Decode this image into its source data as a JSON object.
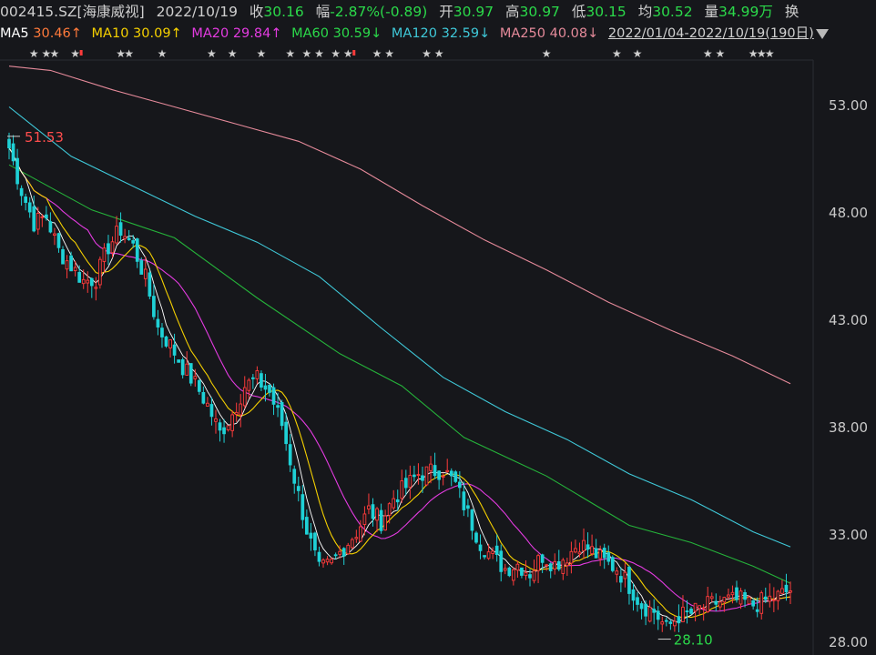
{
  "header": {
    "code": "002415.SZ[海康威视]",
    "date": "2022/10/19",
    "close_label": "收",
    "close": "30.16",
    "change_label": "幅",
    "change": "-2.87%(-0.89)",
    "open_label": "开",
    "open": "30.97",
    "high_label": "高",
    "high": "30.97",
    "low_label": "低",
    "low": "30.15",
    "avg_label": "均",
    "avg": "30.52",
    "vol_label": "量",
    "vol": "34.99万",
    "turnover_label": "换"
  },
  "ma_bar": {
    "ma5_label": "MA5",
    "ma5": "30.46↑",
    "ma10_label": "MA10",
    "ma10": "30.09↑",
    "ma20_label": "MA20",
    "ma20": "29.84↑",
    "ma60_label": "MA60",
    "ma60": "30.59↓",
    "ma120_label": "MA120",
    "ma120": "32.59↓",
    "ma250_label": "MA250",
    "ma250": "40.08↓",
    "range": "2022/01/04-2022/10/19(190日)"
  },
  "colors": {
    "up": "#ff3b3b",
    "down": "#1fd1d6",
    "ma5": "#ffffff",
    "ma10": "#f5d000",
    "ma20": "#e33be0",
    "ma60": "#25b33a",
    "ma120": "#3fc8d8",
    "ma250": "#e58a9a"
  },
  "chart_data": {
    "type": "candlestick",
    "y_ticks": [
      "53.00",
      "48.00",
      "43.00",
      "38.00",
      "33.00",
      "28.00"
    ],
    "ylim": [
      27.7,
      55.0
    ],
    "days": 190,
    "high_annotation": "51.53",
    "low_annotation": "28.10",
    "anchors": [
      [
        0,
        51.0
      ],
      [
        3,
        49.0
      ],
      [
        6,
        47.5
      ],
      [
        9,
        47.8
      ],
      [
        12,
        46.2
      ],
      [
        15,
        45.5
      ],
      [
        18,
        44.8
      ],
      [
        21,
        44.9
      ],
      [
        24,
        46.4
      ],
      [
        27,
        47.2
      ],
      [
        30,
        46.4
      ],
      [
        33,
        44.9
      ],
      [
        36,
        42.6
      ],
      [
        39,
        41.8
      ],
      [
        42,
        40.8
      ],
      [
        45,
        40.0
      ],
      [
        48,
        39.0
      ],
      [
        51,
        37.7
      ],
      [
        54,
        38.6
      ],
      [
        57,
        39.9
      ],
      [
        60,
        40.2
      ],
      [
        63,
        39.6
      ],
      [
        66,
        38.1
      ],
      [
        69,
        35.6
      ],
      [
        72,
        33.2
      ],
      [
        75,
        31.3
      ],
      [
        78,
        31.6
      ],
      [
        81,
        32.4
      ],
      [
        84,
        33.1
      ],
      [
        87,
        34.1
      ],
      [
        90,
        33.6
      ],
      [
        93,
        34.7
      ],
      [
        96,
        35.2
      ],
      [
        99,
        35.8
      ],
      [
        102,
        35.9
      ],
      [
        105,
        36.0
      ],
      [
        108,
        35.3
      ],
      [
        111,
        33.9
      ],
      [
        114,
        32.6
      ],
      [
        117,
        31.9
      ],
      [
        120,
        31.4
      ],
      [
        123,
        31.6
      ],
      [
        126,
        31.2
      ],
      [
        129,
        32.0
      ],
      [
        132,
        31.6
      ],
      [
        135,
        32.0
      ],
      [
        138,
        32.6
      ],
      [
        141,
        32.2
      ],
      [
        144,
        31.7
      ],
      [
        147,
        31.4
      ],
      [
        150,
        30.6
      ],
      [
        153,
        29.7
      ],
      [
        156,
        29.4
      ],
      [
        159,
        28.6
      ],
      [
        162,
        29.2
      ],
      [
        165,
        29.3
      ],
      [
        168,
        29.6
      ],
      [
        171,
        29.8
      ],
      [
        174,
        29.9
      ],
      [
        177,
        29.9
      ],
      [
        180,
        29.7
      ],
      [
        183,
        29.9
      ],
      [
        186,
        30.1
      ],
      [
        189,
        30.4
      ]
    ],
    "ma60_pts": [
      [
        0,
        50.2
      ],
      [
        20,
        48.1
      ],
      [
        40,
        46.8
      ],
      [
        60,
        44.0
      ],
      [
        80,
        41.4
      ],
      [
        95,
        39.9
      ],
      [
        110,
        37.5
      ],
      [
        130,
        35.7
      ],
      [
        150,
        33.4
      ],
      [
        165,
        32.6
      ],
      [
        180,
        31.5
      ],
      [
        189,
        30.7
      ]
    ],
    "ma120_pts": [
      [
        0,
        52.9
      ],
      [
        15,
        50.6
      ],
      [
        30,
        49.2
      ],
      [
        45,
        47.8
      ],
      [
        60,
        46.6
      ],
      [
        75,
        45.0
      ],
      [
        90,
        42.6
      ],
      [
        105,
        40.3
      ],
      [
        120,
        38.7
      ],
      [
        135,
        37.4
      ],
      [
        150,
        35.8
      ],
      [
        165,
        34.6
      ],
      [
        180,
        33.1
      ],
      [
        189,
        32.4
      ]
    ],
    "ma250_pts": [
      [
        0,
        54.8
      ],
      [
        10,
        54.6
      ],
      [
        25,
        53.7
      ],
      [
        40,
        52.9
      ],
      [
        55,
        52.1
      ],
      [
        70,
        51.3
      ],
      [
        85,
        50.0
      ],
      [
        100,
        48.3
      ],
      [
        115,
        46.7
      ],
      [
        130,
        45.3
      ],
      [
        145,
        43.8
      ],
      [
        160,
        42.5
      ],
      [
        175,
        41.3
      ],
      [
        189,
        40.0
      ]
    ],
    "star_positions": [
      6,
      9,
      11,
      16,
      27,
      29,
      37,
      49,
      54,
      61,
      68,
      72,
      75,
      79,
      82,
      89,
      92,
      101,
      104,
      130,
      147,
      152,
      169,
      172,
      180,
      182,
      184
    ]
  }
}
